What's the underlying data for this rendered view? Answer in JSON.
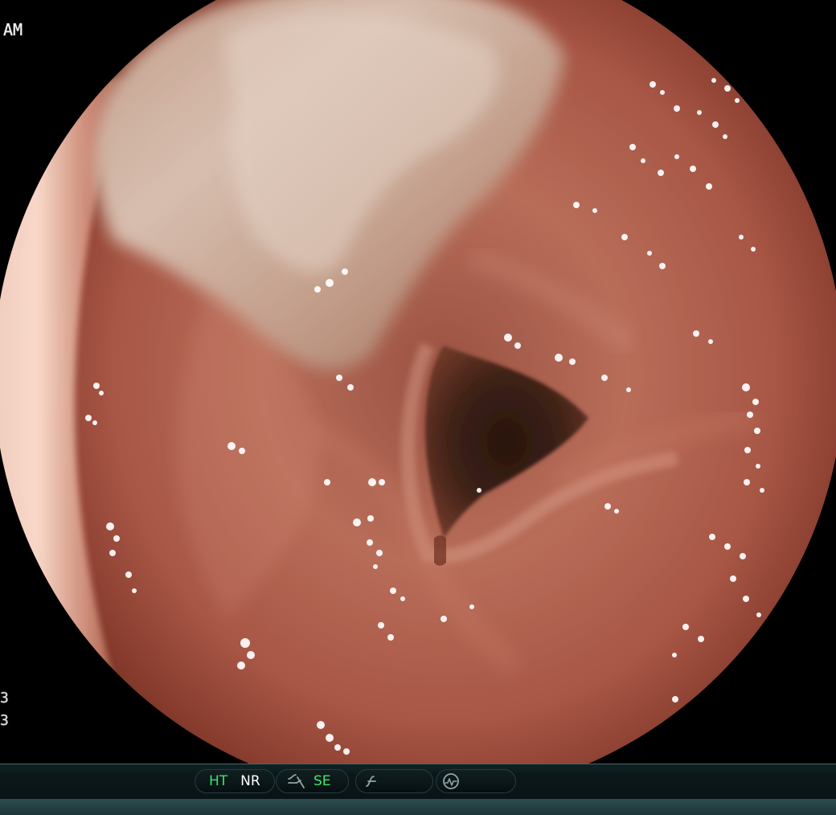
{
  "overlay": {
    "top_left": "AM",
    "left_marks": [
      "3",
      "3"
    ]
  },
  "status_bar": {
    "items": [
      {
        "label": "HT",
        "color": "#35e66e"
      },
      {
        "label": "NR",
        "color": "#ffffff"
      },
      {
        "label": "SE",
        "color": "#3be96f"
      }
    ],
    "icons": [
      "structure-enhancement-icon",
      "curve-icon",
      "waveform-icon"
    ]
  }
}
